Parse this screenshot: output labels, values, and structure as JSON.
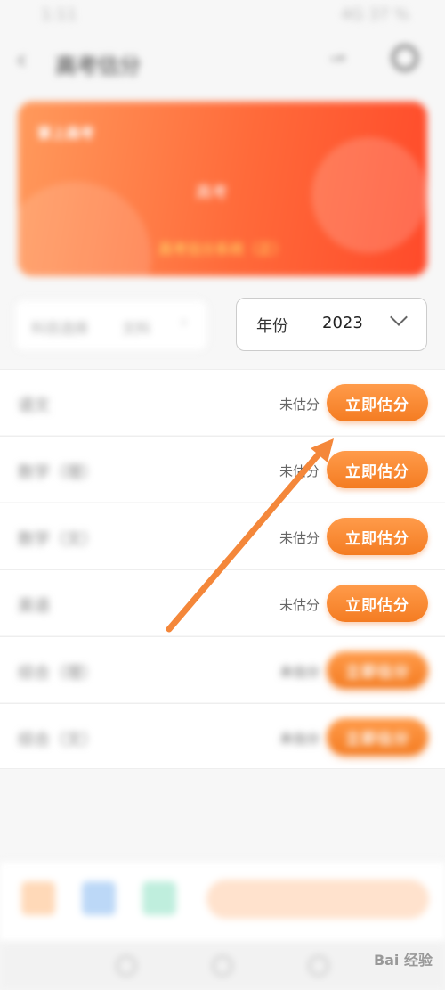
{
  "status_bar": {
    "time": "1:11",
    "right": "4G 37 %"
  },
  "header": {
    "title": "高考估分"
  },
  "banner": {
    "logo": "掌上高考",
    "center": "高考",
    "subtitle": "高考估分系统（正）"
  },
  "filters": {
    "subject_label": "科目选择",
    "subject_value": "文科",
    "year_label": "年份",
    "year_value": "2023"
  },
  "subjects": [
    {
      "name": "语文",
      "status": "未估分",
      "button": "立即估分"
    },
    {
      "name": "数学（理）",
      "status": "未估分",
      "button": "立即估分"
    },
    {
      "name": "数学（文）",
      "status": "未估分",
      "button": "立即估分"
    },
    {
      "name": "英语",
      "status": "未估分",
      "button": "立即估分"
    },
    {
      "name": "综合（理）",
      "status": "未估分",
      "button": "立即估分"
    },
    {
      "name": "综合（文）",
      "status": "未估分",
      "button": "立即估分"
    }
  ],
  "watermark": "Bai 经验",
  "colors": {
    "accent": "#f47c22",
    "banner": "#ff6a3a",
    "annotation_arrow": "#f4873a"
  }
}
